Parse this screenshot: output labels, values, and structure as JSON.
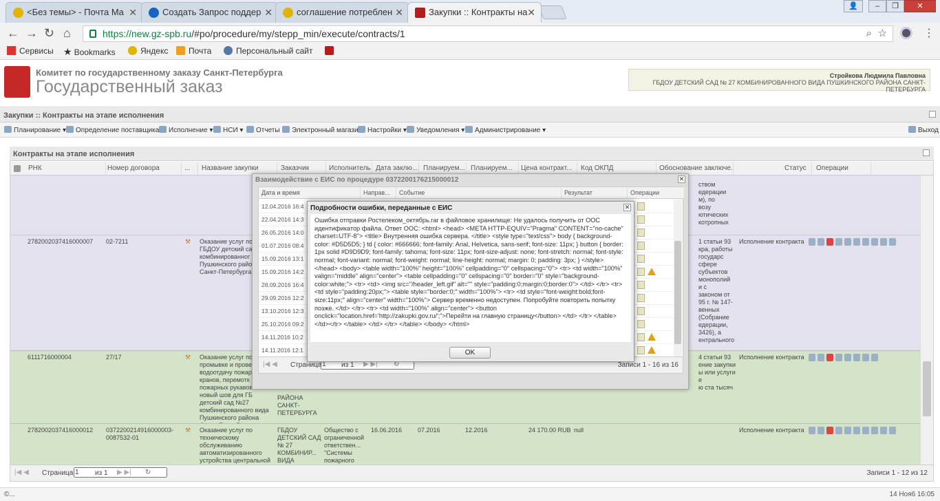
{
  "browser": {
    "tabs": [
      {
        "label": "<Без темы> - Почта Ma"
      },
      {
        "label": "Создать Запрос поддер"
      },
      {
        "label": "соглашение потреблен"
      },
      {
        "label": "Закупки :: Контракты на"
      }
    ],
    "url_host": "https://new.gz-spb.ru",
    "url_path": "/#po/procedure/my/stepp_min/execute/contracts/1",
    "bookmarks": [
      "Сервисы",
      "Bookmarks",
      "Яндекс",
      "Почта",
      "Персональный сайт"
    ]
  },
  "site": {
    "org_line": "Комитет по государственному заказу Санкт-Петербурга",
    "title": "Государственный заказ",
    "user_name": "Стройкова Людмила Павловна",
    "user_org": "ГБДОУ ДЕТСКИЙ САД № 27 КОМБИНИРОВАННОГО ВИДА ПУШКИНСКОГО РАЙОНА САНКТ-ПЕТЕРБУРГА"
  },
  "breadcrumb": "Закупки :: Контракты на этапе исполнения",
  "menu": [
    "Планирование",
    "Определение поставщика",
    "Исполнение",
    "НСИ",
    "Отчеты",
    "Электронный магазин",
    "Настройки",
    "Уведомления",
    "Администрирование"
  ],
  "logout": "Выход",
  "grid": {
    "title": "Контракты на этапе исполнения",
    "columns": [
      "РНК",
      "Номер договора",
      "...",
      "Название закупки",
      "Заказчик",
      "Исполнитель",
      "Дата заклю...",
      "Планируем...",
      "Планируем...",
      "Цена контракт...",
      "Код ОКПД",
      "Обоснование заключе...",
      "Статус",
      "Операции"
    ],
    "rows": [
      {
        "rnk": "",
        "num": "",
        "name": "",
        "customer": "",
        "executor": "",
        "date": "",
        "plan1": "",
        "plan2": "",
        "price": "",
        "okpd": "",
        "basis": "ством\nедерации\nм), по\nвозу\nютических\nкотропных",
        "status": ""
      },
      {
        "rnk": "2782002037416000007",
        "num": "02-7211",
        "name": "Оказание услуг по\nГБДОУ детский са\nкомбинированног\nПушкинского райо\nСанкт-Петербурга",
        "customer": "",
        "executor": "",
        "date": "",
        "plan1": "",
        "plan2": "",
        "price": "",
        "okpd": "",
        "basis": "1 статьи 93\nкра, работы\nгосударс\nсфере\nсубъектов\nмонополий\nи с\nзаконом от\n95 г. № 147-\nвенных\n(Собрание\nедерации,\n3426), а\nентрального",
        "status": "Исполнение контракта"
      },
      {
        "rnk": "6111716000004",
        "num": "27/17",
        "name": "Оказание услуг по\nпромывке и провер\nводоотдачу пожар\nкранов, перемотк\nпожарных рукавов\nновый шов для ГБ\nдетский сад №27\nкомбинированного вида\nПушкинского района\nСанкт-Петербурга",
        "customer": "РАЙОНА\nСАНКТ-\nПЕТЕРБУРГА",
        "executor": "",
        "date": "",
        "plan1": "",
        "plan2": "",
        "price": "",
        "okpd": "",
        "basis": "4 статьи 93\nение закупки\nы или услуги\nе\nю ста тысяч",
        "status": "Исполнение контракта"
      },
      {
        "rnk": "2782002037416000012",
        "num": "0372200214916000003-\n0087532-01",
        "name": "Оказание услуг по\nтехническому\nобслуживанию\nавтоматизированного\nустройства центральной\nавтоматизированной",
        "customer": "ГБДОУ\nДЕТСКИЙ САД\n№ 27\nКОМБИНИР...\nВИДА\nПУШКИНСК...",
        "executor": "Общество с\nограниченной\nответствен...\n\"Системы\nпожарного\nмониторинг\"",
        "date": "16.06.2016",
        "plan1": "07.2016",
        "plan2": "12.2016",
        "price": "24 170.00 RUB",
        "okpd": "null",
        "basis": "",
        "status": "Исполнение контракта"
      }
    ],
    "pager_label": "Страница",
    "pager_page": "1",
    "pager_of": "из 1",
    "records": "Записи 1 - 12 из 12"
  },
  "eis_dialog": {
    "title": "Взаимодействие с ЕИС по процедуре 0372200176215000012",
    "columns": [
      "Дата и время",
      "Направ...",
      "Событие",
      "Результат",
      "Операции"
    ],
    "rows": [
      {
        "date": "12.04.2016 16:4",
        "warn": false
      },
      {
        "date": "22.04.2016 14:3",
        "warn": false
      },
      {
        "date": "26.05.2016 14:0",
        "warn": false
      },
      {
        "date": "01.07.2016 08:4",
        "warn": false
      },
      {
        "date": "15.09.2016 13:1",
        "warn": false
      },
      {
        "date": "15.09.2016 14:2",
        "warn": true
      },
      {
        "date": "28.09.2016 16:4",
        "warn": false
      },
      {
        "date": "29.09.2016 12:2",
        "warn": false
      },
      {
        "date": "13.10.2016 12:3",
        "warn": false
      },
      {
        "date": "25.10.2016 09:2",
        "warn": false
      },
      {
        "date": "14.11.2016 10:2",
        "warn": true
      },
      {
        "date": "14.11.2016 12:1",
        "warn": true
      },
      {
        "date": "14.11.2016 15:4",
        "warn": false
      }
    ],
    "pager_label": "Страница",
    "pager_page": "1",
    "pager_of": "из 1",
    "records": "Записи 1 - 16 из 16"
  },
  "error_dialog": {
    "title": "Подробности ошибки, переданные с ЕИС",
    "message": "Ошибка отправки Ростелеком_октябрь.rar в файловое хранилище: Не удалось получить от ООС идентификатор файла. Ответ ООС: <html> <head> <META HTTP-EQUIV=\"Pragma\" CONTENT=\"no-cache\" charset=UTF-8\"> <title> Внутренняя ошибка сервера. </title> <style type=\"text/css\"> body { background-color: #D5D5D5; } td { color: #666666; font-family: Arial, Helvetica, sans-serif; font-size: 11px; } button { border: 1px solid #D9D9D9; font-family: tahoma; font-size: 11px; font-size-adjust: none; font-stretch: normal; font-style: normal; font-variant: normal; font-weight: normal; line-height: normal; margin: 0; padding: 3px; } </style> </head> <body> <table width=\"100%\" height=\"100%\" cellpadding=\"0\" cellspacing=\"0\"> <tr> <td width=\"100%\" valign=\"middle\" align=\"center\"> <table cellpadding=\"0\" cellspacing=\"0\" border=\"0\" style=\"background-color:white;\"> <tr> <td> <img src=\"/header_left.gif\" alt=\"\" style=\"padding:0;margin:0;border:0\"> </td> </tr> <tr><td style=\"padding:20px;\"> <table style=\"border:0;\" width=\"100%\"> <tr> <td style=\"font-weight:bold;font-size:11px;\" align=\"center\" width=\"100%\"> Сервер временно недоступен. Попробуйте повторить попытку позже. </td> </tr> <tr> <td width=\"100%\" align=\"center\"> <button onclick=\"location.href='http://zakupki.gov.ru/';\">Перейти на главную страницу</button> </td> </tr> </table> </td></tr> </table> </td> </tr> </table> </body> </html>",
    "ok": "OK"
  },
  "statusbar": {
    "left": "©...",
    "right": "14 Ноя6 16:05"
  }
}
